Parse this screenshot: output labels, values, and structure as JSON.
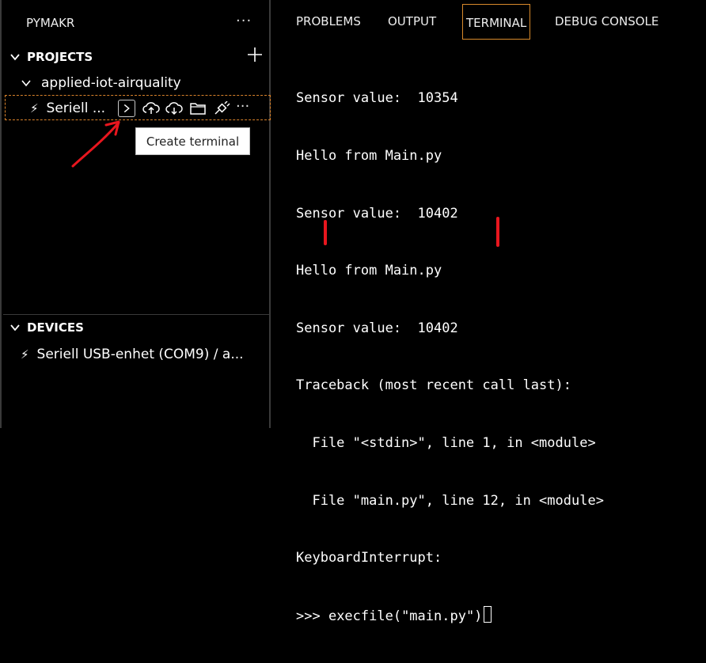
{
  "sidebar": {
    "title": "PYMAKR",
    "more_label": "···",
    "projects": {
      "header": "PROJECTS",
      "project_name": "applied-iot-airquality",
      "device_label": "Seriell ...",
      "more_label": "···",
      "tooltip": "Create terminal"
    },
    "devices": {
      "header": "DEVICES",
      "device_label": "Seriell USB-enhet (COM9) / a..."
    }
  },
  "panel": {
    "tabs": [
      {
        "label": "PROBLEMS",
        "active": false
      },
      {
        "label": "OUTPUT",
        "active": false
      },
      {
        "label": "TERMINAL",
        "active": true
      },
      {
        "label": "DEBUG CONSOLE",
        "active": false
      }
    ]
  },
  "terminal": {
    "lines": [
      "Sensor value:  10354",
      "Hello from Main.py",
      "Sensor value:  10402",
      "Hello from Main.py",
      "Sensor value:  10402",
      "Traceback (most recent call last):",
      "  File \"<stdin>\", line 1, in <module>",
      "  File \"main.py\", line 12, in <module>",
      "KeyboardInterrupt:"
    ],
    "prompt": ">>> ",
    "command": "execfile(\"main.py\")"
  },
  "colors": {
    "background": "#000000",
    "accent_border": "#d98a2b",
    "annotation_red": "#e8161e"
  }
}
